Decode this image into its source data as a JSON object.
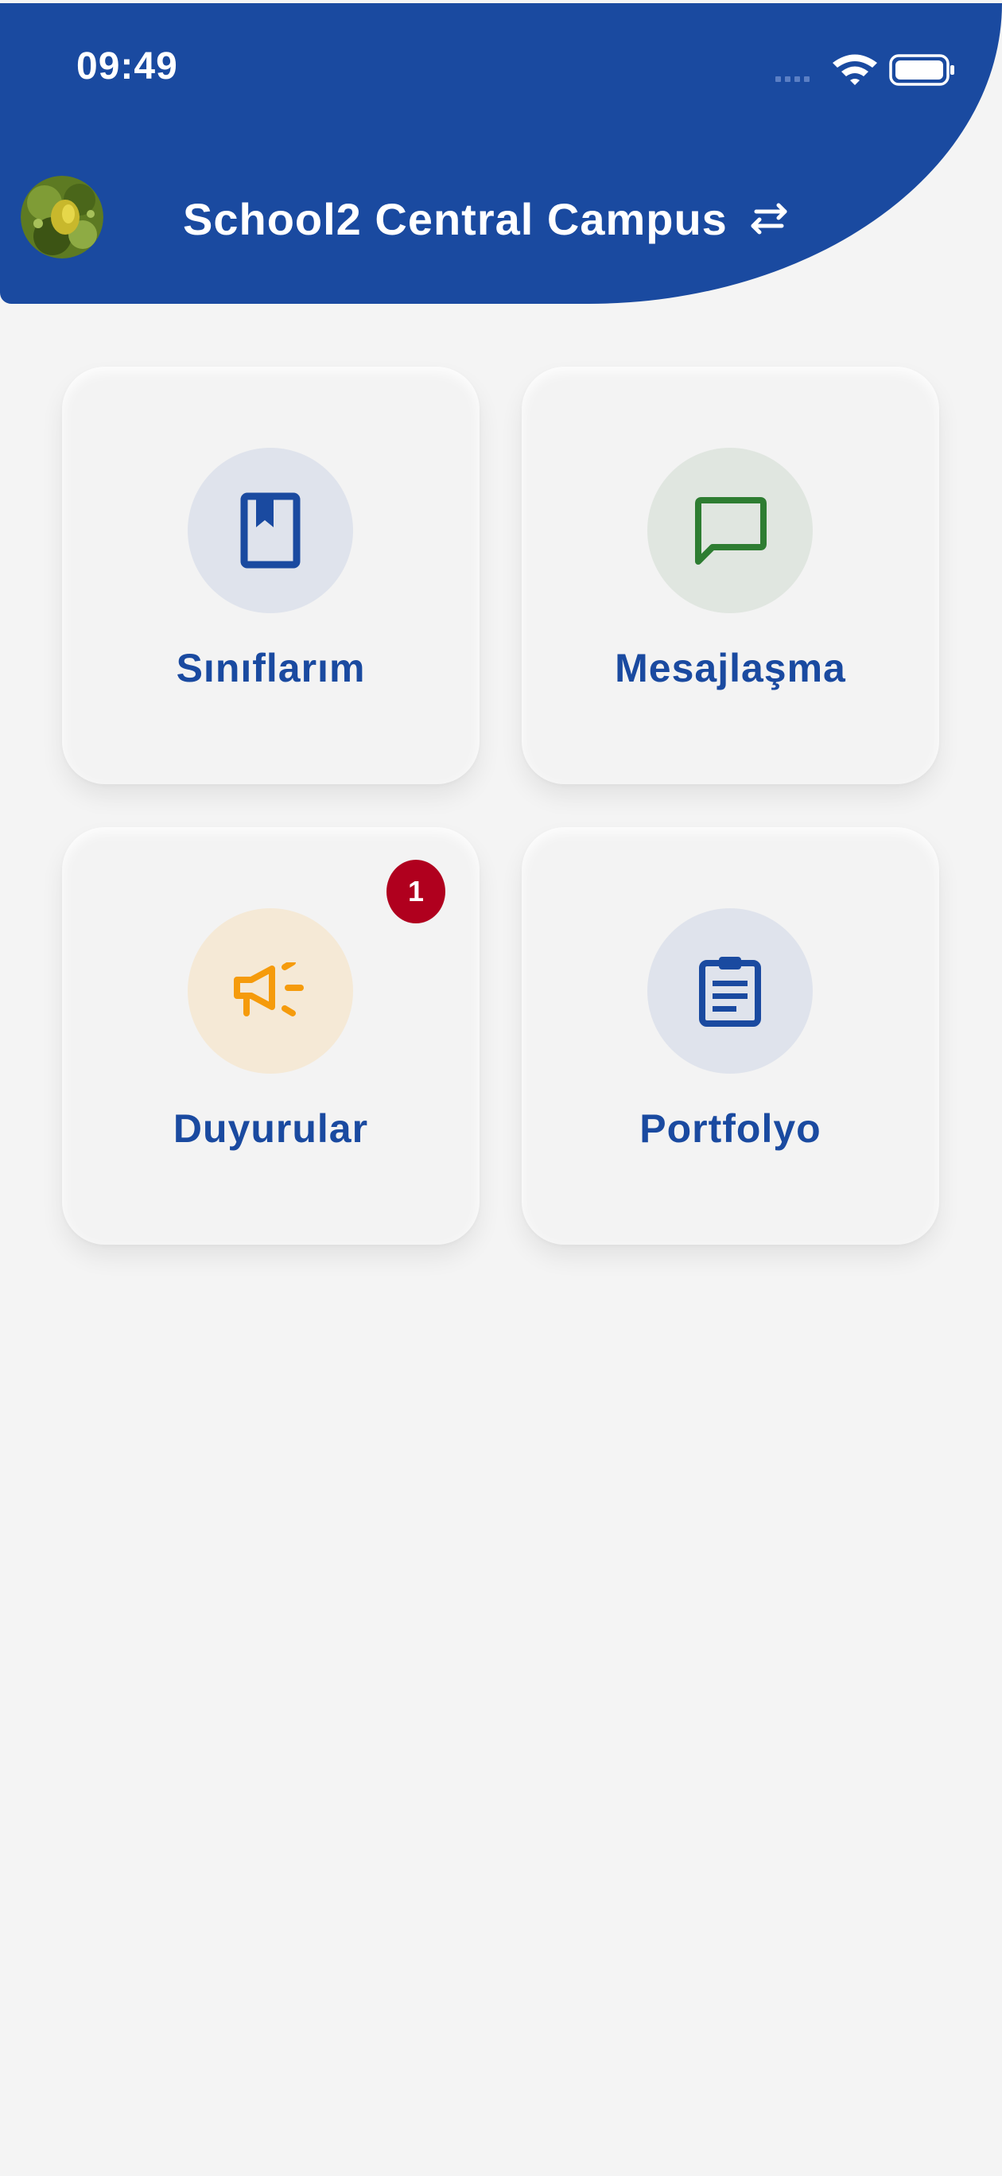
{
  "status_bar": {
    "time": "09:49"
  },
  "header": {
    "campus_name": "School2 Central Campus",
    "avatar_icon": "user-avatar-photo",
    "switch_icon": "swap-arrows-icon",
    "background_color": "#1a4aa0"
  },
  "menu": {
    "items": [
      {
        "label": "Sınıflarım",
        "icon": "bookmark-book-icon",
        "icon_color": "#1a4aa0",
        "circle_color": "#dfe3ec"
      },
      {
        "label": "Mesajlaşma",
        "icon": "chat-bubble-icon",
        "icon_color": "#2e7d32",
        "circle_color": "#e0e6e0"
      },
      {
        "label": "Duyurular",
        "icon": "megaphone-icon",
        "icon_color": "#f59b0c",
        "circle_color": "#f5e9d6",
        "badge": "1"
      },
      {
        "label": "Portfolyo",
        "icon": "clipboard-icon",
        "icon_color": "#1a4aa0",
        "circle_color": "#dfe3ec"
      }
    ]
  },
  "colors": {
    "primary": "#1a4aa0",
    "badge": "#b0001e",
    "page_background": "#f4f4f4"
  }
}
